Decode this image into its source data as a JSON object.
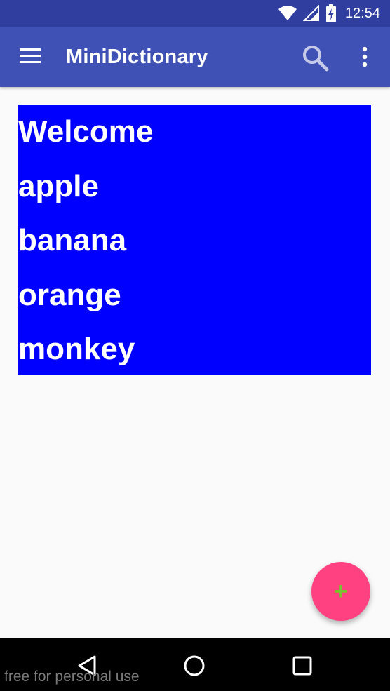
{
  "status_bar": {
    "time": "12:54",
    "icons": [
      "wifi-icon",
      "cell-signal-icon",
      "battery-charging-icon"
    ]
  },
  "app_bar": {
    "title": "MiniDictionary",
    "menu_icon": "hamburger-menu-icon",
    "search_icon": "search-icon",
    "overflow_icon": "overflow-menu-icon",
    "background": "#3f51b5"
  },
  "words": {
    "items": [
      "Welcome",
      "apple",
      "banana",
      "orange",
      "monkey"
    ],
    "background": "#0000ff"
  },
  "fab": {
    "label": "+",
    "background": "#ff4081",
    "icon_color": "#7bc22f"
  },
  "nav_bar": {
    "icons": [
      "back-icon",
      "home-icon",
      "recents-icon"
    ]
  },
  "watermark": "free for personal use"
}
